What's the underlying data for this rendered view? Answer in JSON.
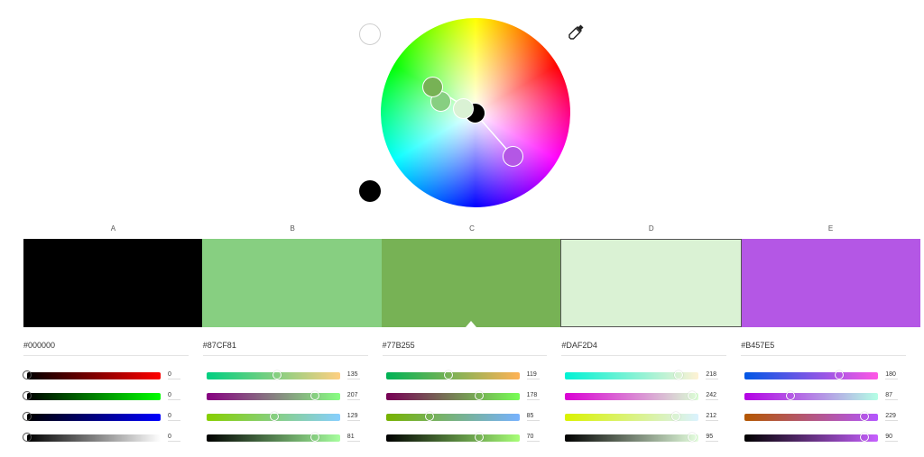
{
  "wheel": {
    "mood_white_icon": "circle-empty-icon",
    "mood_black_icon": "circle-filled-icon",
    "eyedropper_icon": "eyedropper-icon",
    "handles": [
      {
        "name": "handle-a",
        "color": "#000000"
      },
      {
        "name": "handle-b",
        "color": "#87CF81"
      },
      {
        "name": "handle-c",
        "color": "#77B255"
      },
      {
        "name": "handle-d",
        "color": "#DAF2D4"
      },
      {
        "name": "handle-e",
        "color": "#B457E5"
      }
    ]
  },
  "labels": [
    "A",
    "B",
    "C",
    "D",
    "E"
  ],
  "swatches": [
    {
      "hex": "#000000",
      "color": "#000000",
      "r": 0,
      "g": 0,
      "b": 0,
      "k": 0
    },
    {
      "hex": "#87CF81",
      "color": "#87CF81",
      "r": 135,
      "g": 207,
      "b": 129,
      "k": 81
    },
    {
      "hex": "#77B255",
      "color": "#77B255",
      "r": 119,
      "g": 178,
      "b": 85,
      "k": 70
    },
    {
      "hex": "#DAF2D4",
      "color": "#DAF2D4",
      "r": 218,
      "g": 242,
      "b": 212,
      "k": 95
    },
    {
      "hex": "#B457E5",
      "color": "#B457E5",
      "r": 180,
      "g": 87,
      "b": 229,
      "k": 90
    }
  ],
  "selected_index": 2,
  "sliders": [
    [
      {
        "value": "0",
        "level": 0.0,
        "gradient": "linear-gradient(90deg,#000,#ff0000)"
      },
      {
        "value": "0",
        "level": 0.0,
        "gradient": "linear-gradient(90deg,#000,#00ff00)"
      },
      {
        "value": "0",
        "level": 0.0,
        "gradient": "linear-gradient(90deg,#000,#0000ff)"
      },
      {
        "value": "0",
        "level": 0.0,
        "gradient": "linear-gradient(90deg,#000,#ffffff)"
      }
    ],
    [
      {
        "value": "135",
        "level": 0.53,
        "gradient": "linear-gradient(90deg,#00cf81,#ffcf81)"
      },
      {
        "value": "207",
        "level": 0.81,
        "gradient": "linear-gradient(90deg,#870081,#87ff81)"
      },
      {
        "value": "129",
        "level": 0.51,
        "gradient": "linear-gradient(90deg,#87cf00,#87cfff)"
      },
      {
        "value": "81",
        "level": 0.81,
        "gradient": "linear-gradient(90deg,#000000,#a7ff9f)"
      }
    ],
    [
      {
        "value": "119",
        "level": 0.47,
        "gradient": "linear-gradient(90deg,#00b255,#ffb255)"
      },
      {
        "value": "178",
        "level": 0.7,
        "gradient": "linear-gradient(90deg,#770055,#77ff55)"
      },
      {
        "value": "85",
        "level": 0.33,
        "gradient": "linear-gradient(90deg,#77b200,#77b2ff)"
      },
      {
        "value": "70",
        "level": 0.7,
        "gradient": "linear-gradient(90deg,#000000,#a8ff78)"
      }
    ],
    [
      {
        "value": "218",
        "level": 0.85,
        "gradient": "linear-gradient(90deg,#00f2d4,#fff2d4)"
      },
      {
        "value": "242",
        "level": 0.95,
        "gradient": "linear-gradient(90deg,#da00d4,#daffd4)"
      },
      {
        "value": "212",
        "level": 0.83,
        "gradient": "linear-gradient(90deg,#daf200,#daf2ff)"
      },
      {
        "value": "95",
        "level": 0.95,
        "gradient": "linear-gradient(90deg,#000000,#e5ffdf)"
      }
    ],
    [
      {
        "value": "180",
        "level": 0.71,
        "gradient": "linear-gradient(90deg,#0057e5,#ff57e5)"
      },
      {
        "value": "87",
        "level": 0.34,
        "gradient": "linear-gradient(90deg,#b400e5,#b4ffe5)"
      },
      {
        "value": "229",
        "level": 0.9,
        "gradient": "linear-gradient(90deg,#b45700,#b457ff)"
      },
      {
        "value": "90",
        "level": 0.9,
        "gradient": "linear-gradient(90deg,#000000,#c761ff)"
      }
    ]
  ]
}
